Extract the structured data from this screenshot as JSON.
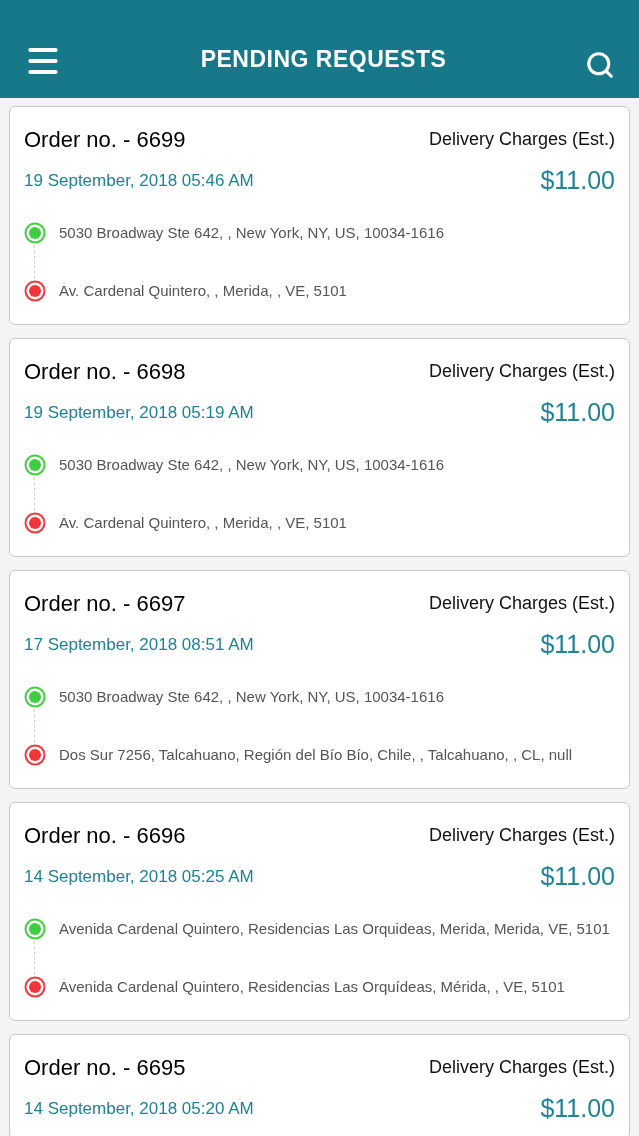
{
  "header": {
    "title": "PENDING REQUESTS"
  },
  "orders": [
    {
      "order": "Order no. - 6699",
      "charges_label": "Delivery Charges (Est.)",
      "date": "19 September, 2018 05:46 AM",
      "price": "$11.00",
      "stops": [
        {
          "kind": "pickup",
          "address": "5030 Broadway Ste 642, , New York, NY, US, 10034-1616"
        },
        {
          "kind": "dropoff",
          "address": "Av. Cardenal Quintero, , Merida, , VE, 5101"
        }
      ]
    },
    {
      "order": "Order no. - 6698",
      "charges_label": "Delivery Charges (Est.)",
      "date": "19 September, 2018 05:19 AM",
      "price": "$11.00",
      "stops": [
        {
          "kind": "pickup",
          "address": "5030 Broadway Ste 642, , New York, NY, US, 10034-1616"
        },
        {
          "kind": "dropoff",
          "address": "Av. Cardenal Quintero, , Merida, , VE, 5101"
        }
      ]
    },
    {
      "order": "Order no. - 6697",
      "charges_label": "Delivery Charges (Est.)",
      "date": "17 September, 2018 08:51 AM",
      "price": "$11.00",
      "stops": [
        {
          "kind": "pickup",
          "address": "5030 Broadway Ste 642, , New York, NY, US, 10034-1616"
        },
        {
          "kind": "dropoff",
          "address": "Dos Sur 7256, Talcahuano, Región del Bío Bío, Chile, , Talcahuano, , CL, null"
        }
      ]
    },
    {
      "order": "Order no. - 6696",
      "charges_label": "Delivery Charges (Est.)",
      "date": "14 September, 2018 05:25 AM",
      "price": "$11.00",
      "stops": [
        {
          "kind": "pickup",
          "address": "Avenida Cardenal Quintero, Residencias Las Orquideas, Merida, Merida, VE, 5101"
        },
        {
          "kind": "dropoff",
          "address": "Avenida Cardenal Quintero, Residencias Las Orquídeas, Mérida, , VE, 5101"
        }
      ]
    },
    {
      "order": "Order no. - 6695",
      "charges_label": "Delivery Charges (Est.)",
      "date": "14 September, 2018 05:20 AM",
      "price": "$11.00"
    }
  ]
}
